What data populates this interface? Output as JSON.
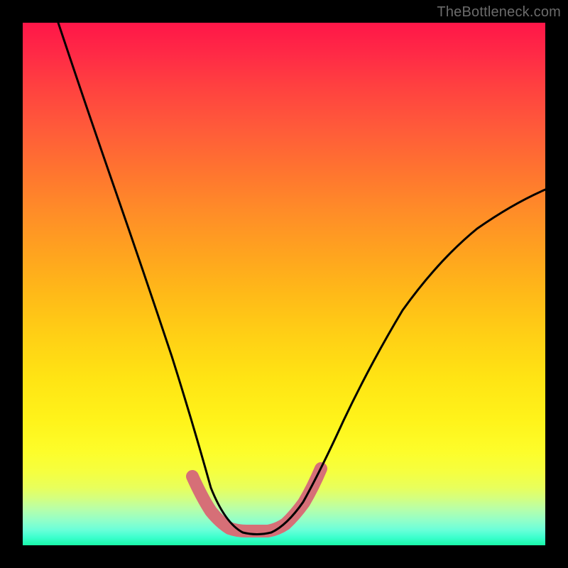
{
  "watermark": "TheBottleneck.com",
  "chart_data": {
    "type": "line",
    "title": "",
    "xlabel": "",
    "ylabel": "",
    "xlim": [
      0,
      100
    ],
    "ylim": [
      0,
      100
    ],
    "grid": false,
    "x": [
      0,
      5,
      10,
      15,
      20,
      25,
      30,
      33,
      36,
      39,
      42,
      45,
      48,
      51,
      54,
      57,
      60,
      65,
      70,
      75,
      80,
      85,
      90,
      95,
      100
    ],
    "series": [
      {
        "name": "bottleneck-curve",
        "values": [
          100,
          87,
          74,
          61,
          48,
          35,
          22,
          14,
          8,
          4,
          2,
          1,
          1,
          2,
          4,
          8,
          13,
          22,
          31,
          39,
          46,
          52,
          57,
          61,
          64
        ]
      }
    ],
    "thresholds": {
      "ideal_max": 6,
      "ideal_highlight_color": "#d66f77"
    },
    "background_gradient": {
      "top": "#ff1648",
      "mid": "#ffe414",
      "bottom": "#18f7a8"
    }
  }
}
